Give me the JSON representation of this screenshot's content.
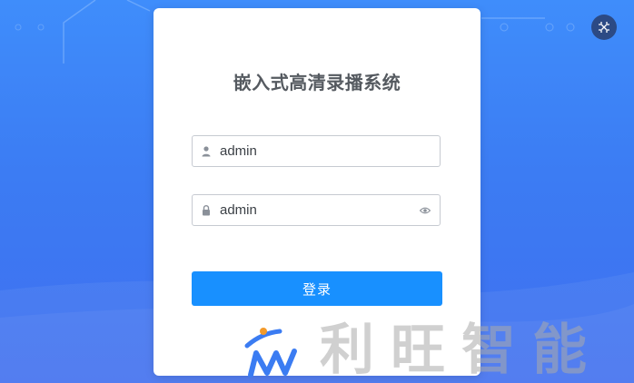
{
  "login": {
    "title": "嵌入式高清录播系统",
    "username": {
      "value": "admin",
      "icon": "user-icon"
    },
    "password": {
      "value": "admin",
      "icon": "lock-icon",
      "toggle_icon": "eye-icon"
    },
    "submit_label": "登录"
  },
  "brand": {
    "name": "利旺智能",
    "logo_icon": "liwang-logo-icon"
  },
  "corner_button": {
    "icon": "fullscreen-exit-icon"
  },
  "colors": {
    "background": "#3f7ef5",
    "card": "#ffffff",
    "primary_button": "#1890ff",
    "title_text": "#555a60",
    "corner_button": "#2c4a84"
  }
}
